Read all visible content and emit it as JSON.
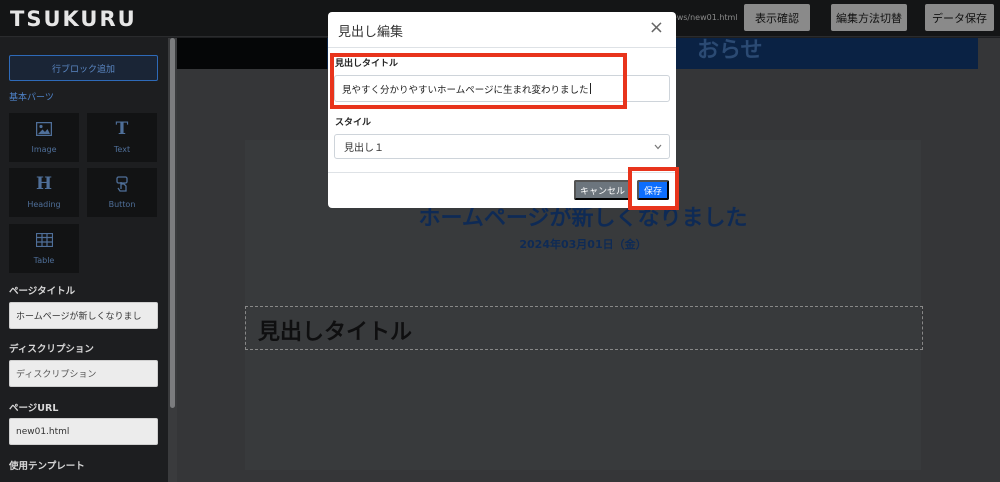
{
  "app": {
    "logo": "TSUKURU"
  },
  "topbar": {
    "url_fragment": "/news/new01.html",
    "buttons": [
      "表示確認",
      "編集方法切替",
      "データ保存"
    ]
  },
  "sidebar": {
    "add_row_label": "行ブロック追加",
    "basic_parts_label": "基本パーツ",
    "parts": [
      {
        "label": "Image",
        "icon": "image-icon"
      },
      {
        "label": "Text",
        "icon": "text-icon"
      },
      {
        "label": "Heading",
        "icon": "heading-icon"
      },
      {
        "label": "Button",
        "icon": "button-icon"
      },
      {
        "label": "Table",
        "icon": "table-icon"
      }
    ],
    "page_title_label": "ページタイトル",
    "page_title_value": "ホームページが新しくなりまし",
    "description_label": "ディスクリプション",
    "description_placeholder": "ディスクリプション",
    "page_url_label": "ページURL",
    "page_url_value": "new01.html",
    "template_label": "使用テンプレート"
  },
  "canvas": {
    "banner_partial_text": "おらせ",
    "page_heading": "ホームページが新しくなりました",
    "page_date": "2024年03月01日（金）",
    "heading_block_text": "見出しタイトル"
  },
  "modal": {
    "title": "見出し編集",
    "close_symbol": "×",
    "title_field_label": "見出しタイトル",
    "title_field_value": "見やすく分かりやすいホームページに生まれ変わりました",
    "style_field_label": "スタイル",
    "style_selected": "見出し１",
    "cancel_label": "キャンセル",
    "save_label": "保存"
  },
  "colors": {
    "highlight": "#e8341c",
    "primary": "#0d6efd",
    "secondary": "#6c757d",
    "heading_navy": "#0e2a55"
  }
}
